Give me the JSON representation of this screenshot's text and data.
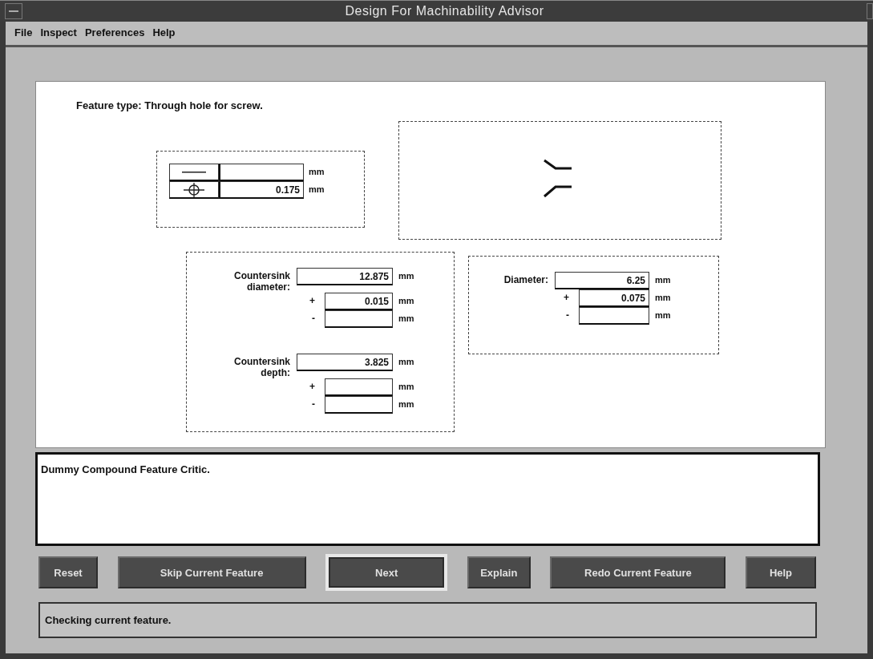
{
  "window": {
    "title": "Design For Machinability Advisor"
  },
  "menu": [
    "File",
    "Inspect",
    "Preferences",
    "Help"
  ],
  "feature_type": "Feature type: Through hole for screw.",
  "tolerance_table": [
    {
      "kind": "straightness",
      "unit": "mm"
    },
    {
      "kind": "position",
      "value": "0.175",
      "unit": "mm"
    }
  ],
  "countersink": [
    {
      "label": "Countersink diameter:",
      "value": "12.875",
      "unit": "mm",
      "plus": {
        "sign": "+",
        "value": "0.015",
        "unit": "mm"
      },
      "minus": {
        "sign": "-",
        "unit": "mm"
      }
    },
    {
      "label": "Countersink depth:",
      "value": "3.825",
      "unit": "mm",
      "plus": {
        "sign": "+",
        "unit": "mm"
      },
      "minus": {
        "sign": "-",
        "unit": "mm"
      }
    }
  ],
  "hole": [
    {
      "label": "Diameter:",
      "value": "6.25",
      "unit": "mm",
      "plus": {
        "sign": "+",
        "value": "0.075",
        "unit": "mm"
      },
      "minus": {
        "sign": "-",
        "unit": "mm"
      }
    }
  ],
  "message": "Dummy Compound Feature Critic.",
  "buttons": [
    {
      "label": "Reset",
      "default": false
    },
    {
      "label": "Skip Current Feature",
      "default": false
    },
    {
      "label": "Next",
      "default": true
    },
    {
      "label": "Explain",
      "default": false
    },
    {
      "label": "Redo Current Feature",
      "default": false
    },
    {
      "label": "Help",
      "default": false
    }
  ],
  "status": "Checking current feature."
}
